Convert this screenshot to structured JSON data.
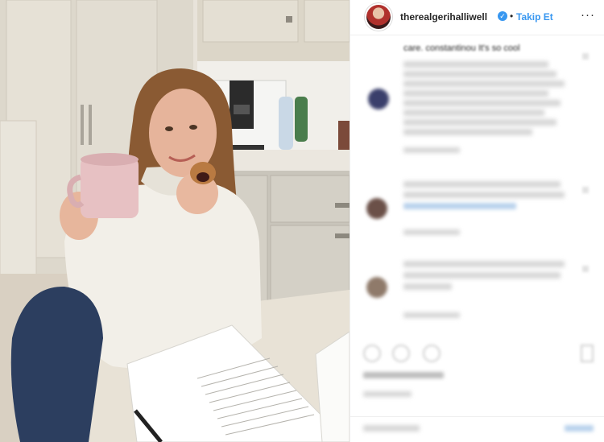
{
  "post": {
    "username": "therealgerihalliwell",
    "verified_icon": "verified-check-icon",
    "separator": "•",
    "follow_label": "Takip Et",
    "more_icon": "···",
    "caption_visible": "care. constantinou It's so cool"
  },
  "colors": {
    "link_blue": "#3897f0",
    "text": "#262626",
    "border": "#efefef"
  },
  "icons": [
    "heart-icon",
    "comment-icon",
    "share-icon",
    "bookmark-icon"
  ]
}
